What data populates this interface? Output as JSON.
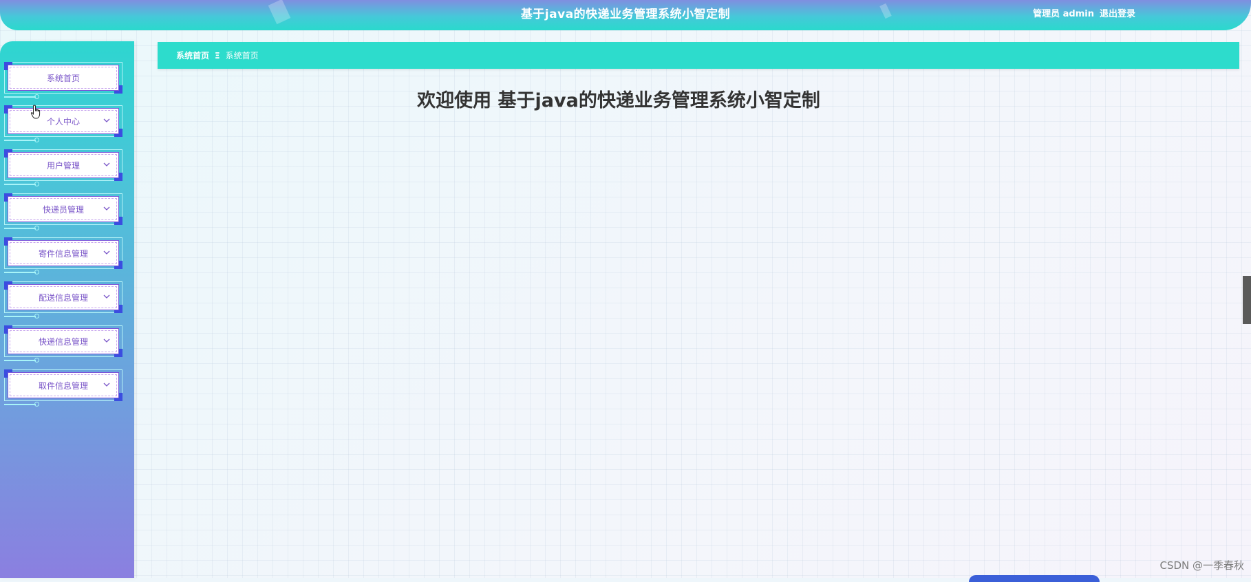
{
  "header": {
    "title": "基于java的快递业务管理系统小智定制",
    "user_label": "管理员 admin",
    "logout_label": "退出登录"
  },
  "sidebar": {
    "items": [
      {
        "label": "系统首页",
        "has_chevron": false,
        "icon": "chevron-down-icon"
      },
      {
        "label": "个人中心",
        "has_chevron": true,
        "icon": "chevron-down-icon"
      },
      {
        "label": "用户管理",
        "has_chevron": true,
        "icon": "chevron-down-icon"
      },
      {
        "label": "快递员管理",
        "has_chevron": true,
        "icon": "chevron-down-icon"
      },
      {
        "label": "寄件信息管理",
        "has_chevron": true,
        "icon": "chevron-down-icon"
      },
      {
        "label": "配送信息管理",
        "has_chevron": true,
        "icon": "chevron-down-icon"
      },
      {
        "label": "快递信息管理",
        "has_chevron": true,
        "icon": "chevron-down-icon"
      },
      {
        "label": "取件信息管理",
        "has_chevron": true,
        "icon": "chevron-down-icon"
      }
    ]
  },
  "breadcrumb": {
    "home": "系统首页",
    "separator": "Ξ",
    "current": "系统首页"
  },
  "main": {
    "welcome": "欢迎使用 基于java的快递业务管理系统小智定制"
  },
  "watermark": "CSDN @一季春秋",
  "colors": {
    "accent": "#2ddccc",
    "menu_border": "#7a55d8",
    "corner": "#3b4de0"
  }
}
